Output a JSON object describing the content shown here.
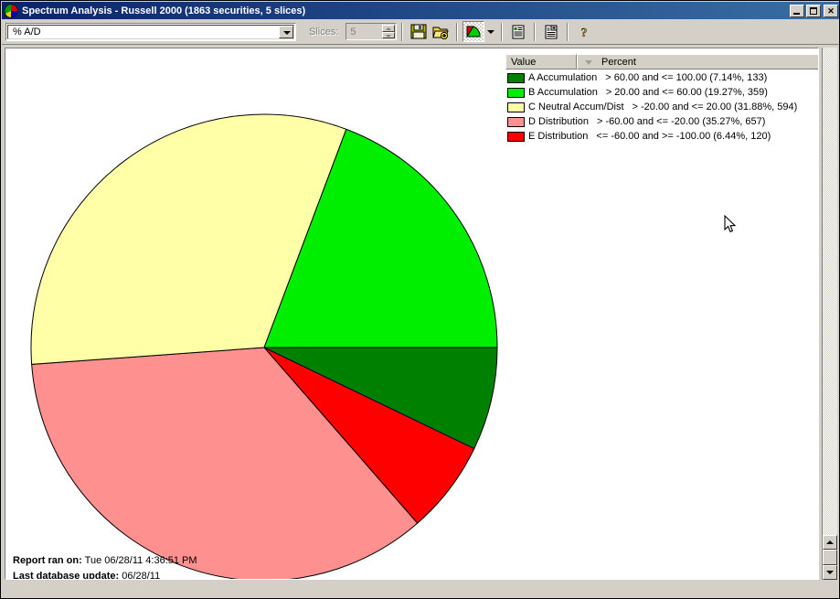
{
  "window": {
    "title": "Spectrum Analysis - Russell 2000 (1863 securities, 5 slices)",
    "icon": "pie-chart-icon",
    "minimize_label": "",
    "maximize_label": "",
    "close_label": "✕"
  },
  "toolbar": {
    "type_select_value": "% A/D",
    "slices_label": "Slices:",
    "slices_value": "5",
    "buttons": [
      {
        "name": "save-button",
        "icon": "floppy-disk-icon",
        "label": ""
      },
      {
        "name": "open-add-button",
        "icon": "folder-add-icon",
        "label": ""
      },
      {
        "name": "chart-type-button",
        "icon": "pie-chart-icon",
        "label": ""
      },
      {
        "name": "chart-type-dropdown",
        "icon": "chevron-down-icon",
        "label": ""
      },
      {
        "name": "report-list-button",
        "icon": "list-report-icon",
        "label": ""
      },
      {
        "name": "report-detail-button",
        "icon": "detail-report-icon",
        "label": ""
      },
      {
        "name": "help-button",
        "icon": "question-mark-icon",
        "label": "?"
      }
    ]
  },
  "legend": {
    "columns": [
      "Value",
      "Percent"
    ],
    "sort_indicator": "descending",
    "rows": [
      {
        "color": "#008000",
        "name": "A Accumulation",
        "desc": "> 60.00 and <= 100.00 (7.14%, 133)"
      },
      {
        "color": "#00EE00",
        "name": "B Accumulation",
        "desc": "> 20.00 and <= 60.00 (19.27%, 359)"
      },
      {
        "color": "#FFFFA8",
        "name": "C Neutral Accum/Dist",
        "desc": "> -20.00 and <= 20.00 (31.88%, 594)"
      },
      {
        "color": "#FF9090",
        "name": "D Distribution",
        "desc": "> -60.00 and <= -20.00 (35.27%, 657)"
      },
      {
        "color": "#FF0000",
        "name": "E Distribution",
        "desc": "<= -60.00 and >= -100.00 (6.44%, 120)"
      }
    ]
  },
  "footer": {
    "report_ran_label": "Report ran on:",
    "report_ran_value": "Tue 06/28/11 4:36:51 PM",
    "db_update_label": "Last database update:",
    "db_update_value": "06/28/11"
  },
  "scrollbar": {
    "up_arrow": "scroll-up-icon",
    "down_arrow": "scroll-down-icon"
  },
  "chart_data": {
    "type": "pie",
    "title": "Spectrum Analysis - Russell 2000",
    "total_securities": 1863,
    "slice_count": 5,
    "start_angle_deg": 0,
    "direction": "clockwise",
    "center": [
      283,
      327
    ],
    "radius": 255,
    "categories": [
      "A Accumulation",
      "E Distribution",
      "D Distribution",
      "C Neutral Accum/Dist",
      "B Accumulation"
    ],
    "values": [
      7.14,
      6.44,
      35.27,
      31.88,
      19.27
    ],
    "counts": [
      133,
      120,
      657,
      594,
      359
    ],
    "colors": [
      "#008000",
      "#FF0000",
      "#FF9090",
      "#FFFFA8",
      "#00EE00"
    ],
    "ranges": [
      "> 60.00 and <= 100.00",
      "<= -60.00 and >= -100.00",
      "> -60.00 and <= -20.00",
      "> -20.00 and <= 20.00",
      "> 20.00 and <= 60.00"
    ],
    "xlabel": "",
    "ylabel": "",
    "legend_position": "top-right"
  }
}
